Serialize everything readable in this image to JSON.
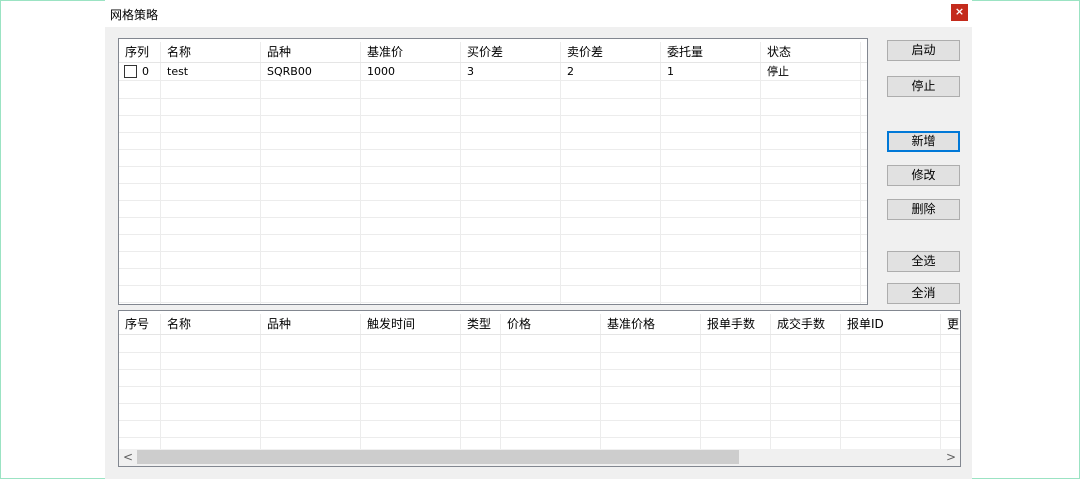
{
  "window": {
    "title": "网格策略",
    "close": "×"
  },
  "strategy_table": {
    "headers": [
      "序列",
      "名称",
      "品种",
      "基准价",
      "买价差",
      "卖价差",
      "委托量",
      "状态"
    ],
    "rows": [
      [
        "0",
        "test",
        "SQRB00",
        "1000",
        "3",
        "2",
        "1",
        "停止"
      ]
    ]
  },
  "buttons": {
    "start": "启动",
    "stop": "停止",
    "add": "新增",
    "modify": "修改",
    "delete": "删除",
    "select_all": "全选",
    "deselect_all": "全消"
  },
  "orders_table": {
    "headers": [
      "序号",
      "名称",
      "品种",
      "触发时间",
      "类型",
      "价格",
      "基准价格",
      "报单手数",
      "成交手数",
      "报单ID",
      "更"
    ]
  },
  "scrollbar": {
    "left_arrow": "<",
    "right_arrow": ">"
  }
}
